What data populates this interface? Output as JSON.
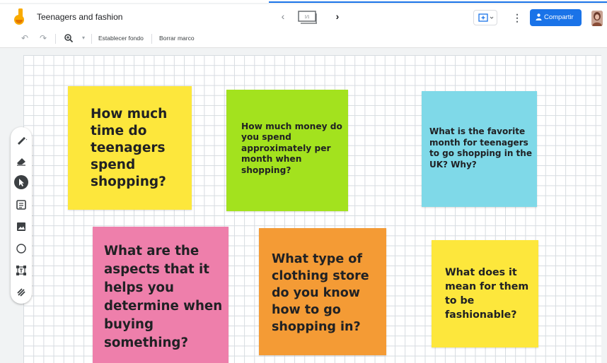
{
  "app": {
    "title": "Teenagers and fashion",
    "frame_counter": "1/1",
    "share_label": "Compartir"
  },
  "toolbar": {
    "set_background": "Establecer fondo",
    "clear_frame": "Borrar marco"
  },
  "colors": {
    "accent": "#1a73e8",
    "yellow": "#fde73c",
    "lime": "#a3e21e",
    "cyan": "#7fd9e8",
    "pink": "#ee7fab",
    "orange": "#f49b35"
  },
  "side_tools": [
    "pen-icon",
    "eraser-icon",
    "select-icon",
    "sticky-note-icon",
    "image-icon",
    "circle-icon",
    "text-box-icon",
    "laser-icon"
  ],
  "notes": [
    {
      "id": "note-time",
      "text": "How much time do teenagers spend shopping?"
    },
    {
      "id": "note-money",
      "text": "How much money do you spend approximately per month when shopping?"
    },
    {
      "id": "note-month",
      "text": "What is the favorite month for teenagers to go shopping in the UK? Why?"
    },
    {
      "id": "note-aspects",
      "text": "What are the aspects that it helps you determine when buying something?"
    },
    {
      "id": "note-store",
      "text": "What type of clothing store do you know how to go shopping in?"
    },
    {
      "id": "note-fashionable",
      "text": "What does it mean for them to be fashionable?"
    }
  ]
}
